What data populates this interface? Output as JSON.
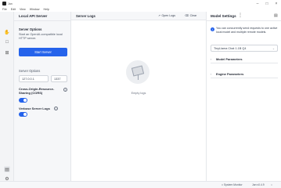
{
  "window": {
    "title": "Jan",
    "controls": [
      "–",
      "□",
      "×"
    ]
  },
  "menu": [
    "File",
    "Edit",
    "View",
    "Window",
    "Help"
  ],
  "server": {
    "panel_title": "Local API Server",
    "options_heading": "Server Options",
    "description": "Start an OpenAI-compatible local HTTP server.",
    "start_button": "Start Server",
    "server_options_label": "Server Options",
    "host": "127.0.0.1",
    "port": "1337",
    "cors_label": "Cross-Origin-Resource-Sharing (CORS)",
    "cors_enabled": true,
    "verbose_label": "Verbose Server Logs",
    "verbose_enabled": true
  },
  "logs": {
    "title": "Server Logs",
    "open_logs": "Open Logs",
    "clear": "Clear",
    "empty_label": "Empty logs"
  },
  "settings": {
    "title": "Model Settings",
    "notice": "You can concurrently send requests to one active local model and multiple remote models.",
    "selected_model": "TinyLlama Chat 1.1B Q4",
    "sections": [
      "Model Parameters",
      "Engine Parameters"
    ]
  },
  "status": {
    "system_monitor": "System Monitor",
    "version": "Jan v0.4.9"
  }
}
